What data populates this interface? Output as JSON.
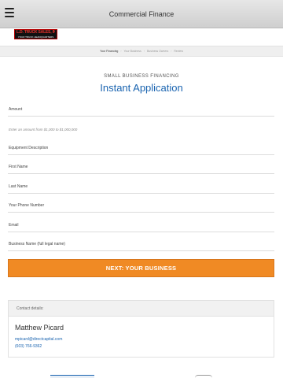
{
  "header": {
    "title": "Commercial Finance",
    "menu_icon": "hamburger-icon"
  },
  "logo": {
    "top_text": "L.D. TRUCK SALES, INC.",
    "bottom_text": "YOUR TRUCK HEADQUARTERS"
  },
  "steps": [
    "Your Financing",
    "Your Business",
    "Business Owners",
    "Review"
  ],
  "hero": {
    "kicker": "SMALL BUSINESS FINANCING",
    "title": "Instant Application"
  },
  "form": {
    "amount_label": "Amount",
    "amount_hint": "Enter an amount from $1,000 to $1,000,000",
    "equipment_label": "Equipment Description",
    "first_name_label": "First Name",
    "last_name_label": "Last Name",
    "phone_label": "Your Phone Number",
    "email_label": "Email",
    "business_name_label": "Business Name (full legal name)",
    "next_button": "NEXT: YOUR BUSINESS"
  },
  "contact": {
    "header": "Contact details:",
    "name": "Matthew Picard",
    "email": "mpicard@directcapital.com",
    "phone": "(603) 766-9362"
  }
}
